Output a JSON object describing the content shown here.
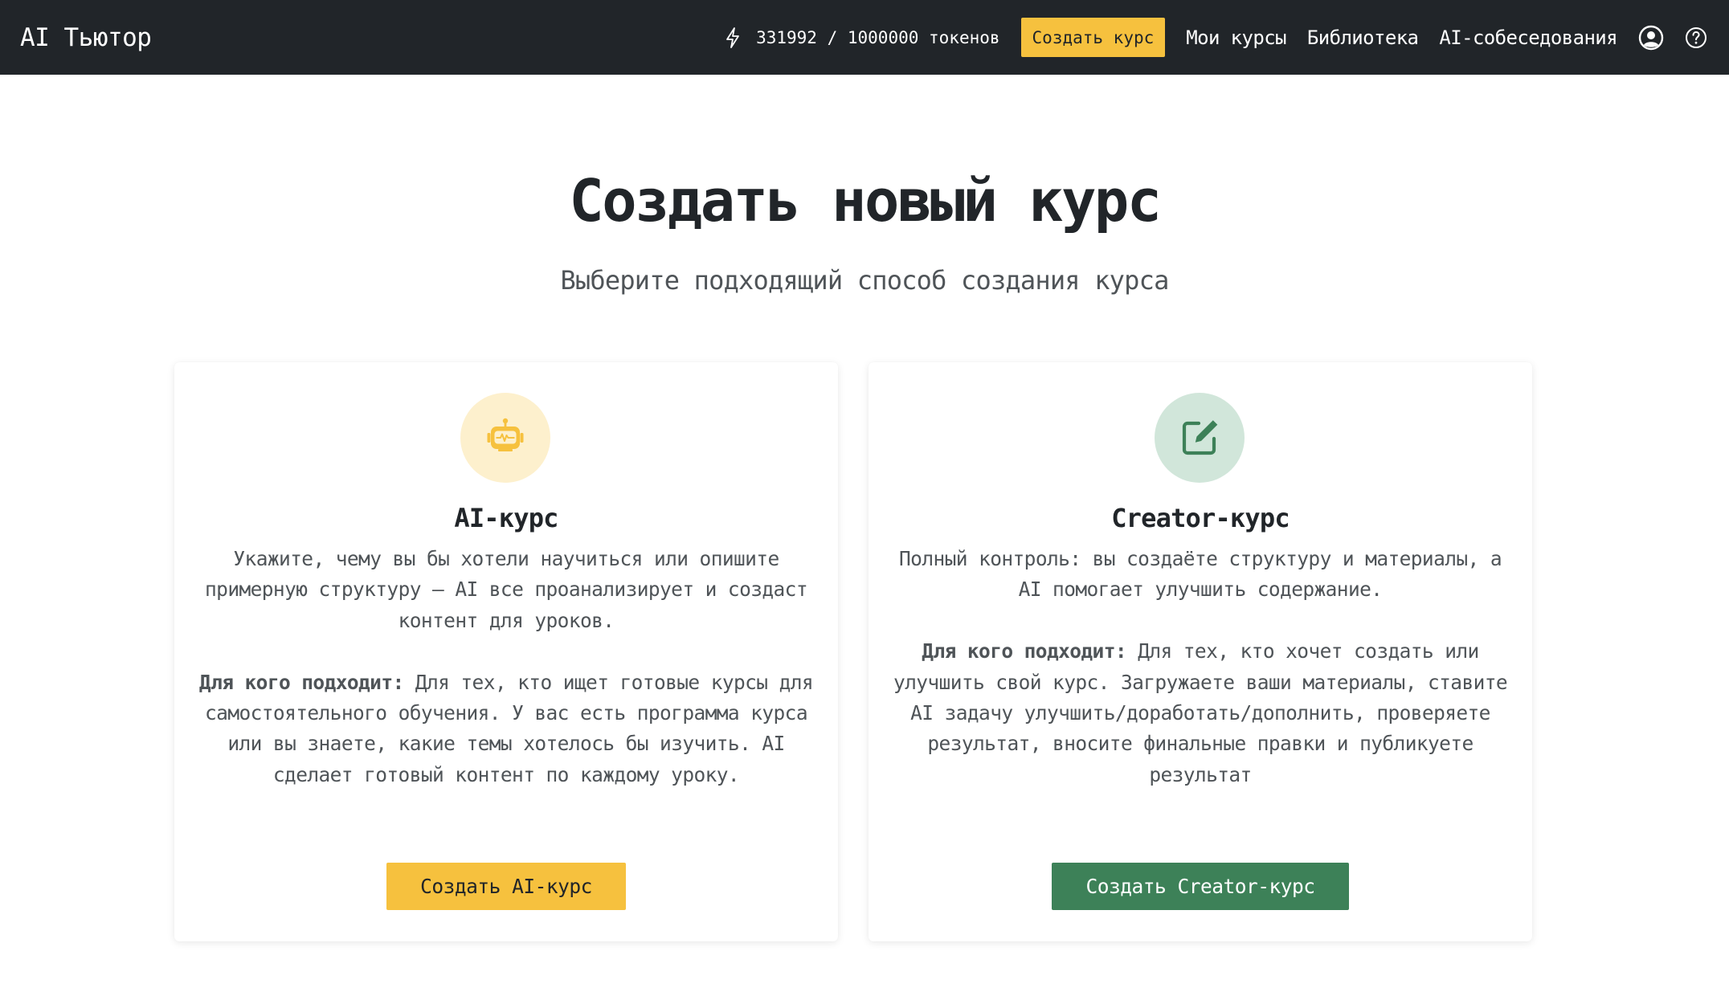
{
  "navbar": {
    "brand": "AI Тьютор",
    "tokens_text": "331992 / 1000000 токенов",
    "create_course_label": "Создать курс",
    "links": [
      "Мои курсы",
      "Библиотека",
      "AI-собеседования"
    ],
    "icons": [
      "bolt-icon",
      "user-circle-icon",
      "question-circle-icon"
    ]
  },
  "hero": {
    "title": "Создать новый курс",
    "subtitle": "Выберите подходящий способ создания курса"
  },
  "cards": [
    {
      "icon": "robot-icon",
      "title": "AI-курс",
      "description": "Укажите, чему вы бы хотели научиться или опишите примерную структуру — AI все проанализирует и создаст контент для уроков.",
      "audience_label": "Для кого подходит:",
      "audience_text": "Для тех, кто ищет готовые курсы для самостоятельного обучения. У вас есть программа курса или вы знаете, какие темы хотелось бы изучить. AI сделает готовый контент по каждому уроку.",
      "button_label": "Создать AI-курс"
    },
    {
      "icon": "edit-icon",
      "title": "Creator-курс",
      "description": "Полный контроль: вы создаёте структуру и материалы, а AI помогает улучшить содержание.",
      "audience_label": "Для кого подходит:",
      "audience_text": "Для тех, кто хочет создать или улучшить свой курс. Загружаете ваши материалы, ставите AI задачу улучшить/доработать/дополнить, проверяете результат, вносите финальные правки и публикуете результат",
      "button_label": "Создать Creator-курс"
    }
  ],
  "colors": {
    "navbar_bg": "#212529",
    "accent_yellow": "#f6c13e",
    "accent_green": "#3d8158",
    "yellow_icon_bg": "#fdf0cd",
    "green_icon_bg": "#d1e6da"
  }
}
